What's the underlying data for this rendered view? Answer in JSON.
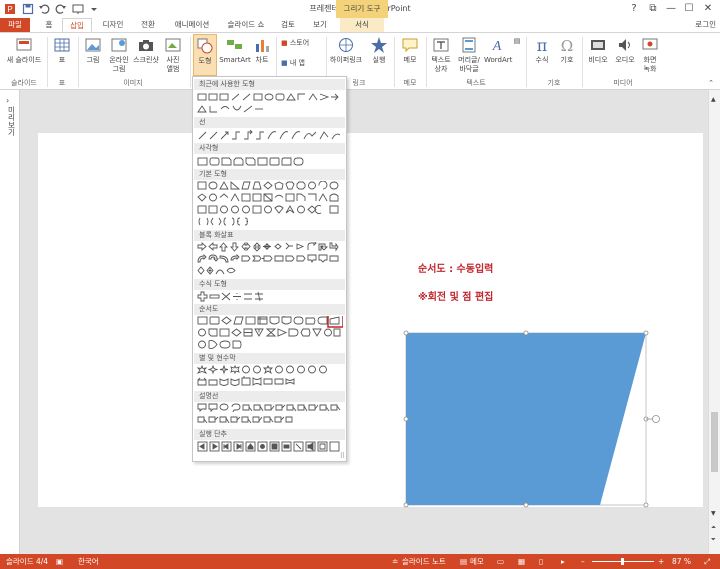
{
  "window": {
    "title": "프레젠테이션1 - PowerPoint",
    "context_tab_header": "그리기 도구",
    "controls": {
      "help": "?",
      "restore": "⧉",
      "minimize": "—",
      "maximize": "☐",
      "close": "✕"
    }
  },
  "tabs": [
    "파일",
    "홈",
    "삽입",
    "디자인",
    "전환",
    "애니메이션",
    "슬라이드 쇼",
    "검토",
    "보기",
    "서식"
  ],
  "account": "로그인",
  "ribbon": {
    "buttons": {
      "new_slide": "새 슬라이드",
      "table": "표",
      "picture": "그림",
      "online_picture_1": "온라인",
      "online_picture_2": "그림",
      "screenshot": "스크린샷",
      "album_1": "사진",
      "album_2": "앨범",
      "shapes": "도형",
      "smartart": "SmartArt",
      "chart": "차트",
      "store": "스토어",
      "my_apps": "내 앱",
      "hyperlink": "하이퍼링크",
      "action": "실행",
      "comment": "메모",
      "textbox_1": "텍스트",
      "textbox_2": "상자",
      "header_footer_1": "머리글/",
      "header_footer_2": "바닥글",
      "wordart": "WordArt",
      "equation": "수식",
      "symbol": "기호",
      "video": "비디오",
      "audio": "오디오",
      "screen_record_1": "화면",
      "screen_record_2": "녹화"
    },
    "groups": {
      "slides": "슬라이드",
      "tables": "표",
      "images": "이미지",
      "links": "링크",
      "comments": "메모",
      "text": "텍스트",
      "symbols": "기호",
      "media": "미디어"
    }
  },
  "thumbnail_pane": {
    "label": "미리보기"
  },
  "gallery": {
    "categories": [
      "최근에 사용한 도형",
      "선",
      "사각형",
      "기본 도형",
      "블록 화살표",
      "수식 도형",
      "순서도",
      "별 및 현수막",
      "설명선",
      "실행 단추"
    ]
  },
  "slide": {
    "text1": "순서도 : 수동입력",
    "text2": "※회전 및 점 편집",
    "shape_fill": "#5b9bd5"
  },
  "status": {
    "slide_info": "슬라이드 4/4",
    "language": "한국어",
    "notes": "슬라이드 노트",
    "comments": "메모",
    "zoom": "87 %"
  },
  "colors": {
    "accent": "#d24726",
    "highlight": "#c0262d",
    "tab_context": "#f3d27a"
  }
}
